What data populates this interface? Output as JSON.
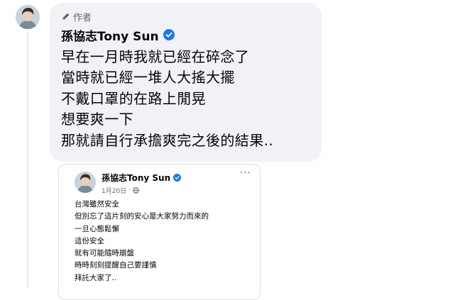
{
  "comment": {
    "author_badge_label": "作者",
    "author_name": "孫協志Tony Sun",
    "lines": [
      "早在一月時我就已經在碎念了",
      "當時就已經一堆人大搖大擺",
      "不戴口罩的在路上閒晃",
      "想要爽一下",
      "那就請自行承擔爽完之後的結果.."
    ]
  },
  "embedded_post": {
    "author_name": "孫協志Tony Sun",
    "date": "1月20日",
    "more_label": "···",
    "lines": [
      "台灣雖然安全",
      "但別忘了這片刻的安心是大家努力而來的",
      "一旦心態鬆懈",
      "這份安全",
      "就有可能隨時崩盤",
      "時時刻刻提醒自己要謹慎",
      "拜託大家了.."
    ]
  },
  "icons": {
    "author_badge": "pencil-icon",
    "verified": "verified-badge-icon",
    "privacy": "globe-icon",
    "more": "more-options-icon"
  },
  "colors": {
    "bubble_bg": "#f0f2f5",
    "verified_blue": "#1877f2",
    "secondary_text": "#65676b"
  }
}
